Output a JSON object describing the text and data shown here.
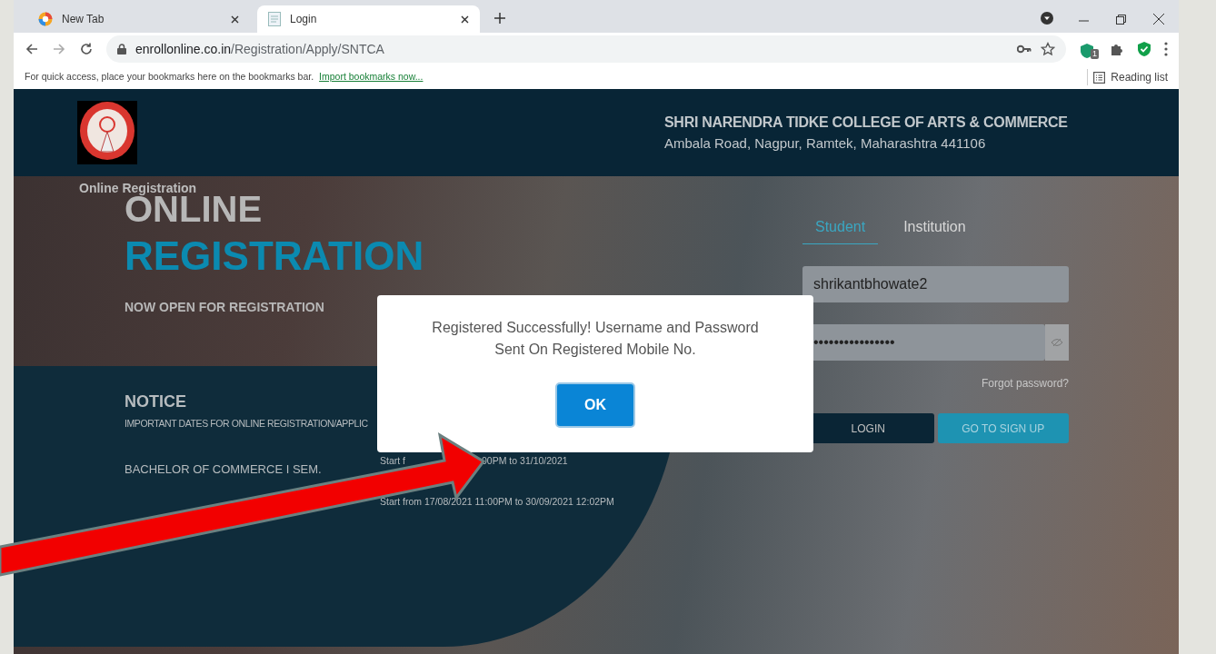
{
  "browser": {
    "tabs": [
      {
        "title": "New Tab",
        "selected": false
      },
      {
        "title": "Login",
        "selected": true
      }
    ],
    "url": {
      "host": "enrollonline.co.in",
      "path": "/Registration/Apply/SNTCA"
    },
    "extension_badge": "1",
    "bookmarks_bar": {
      "message": "For quick access, place your bookmarks here on the bookmarks bar.",
      "link": "Import bookmarks now...",
      "reading_list": "Reading list"
    }
  },
  "page": {
    "college_name": "SHRI NARENDRA TIDKE COLLEGE OF ARTS & COMMERCE",
    "address": "Ambala Road, Nagpur, Ramtek, Maharashtra 441106",
    "breadcrumb": "Online Registration",
    "hero_line_1": "ONLINE",
    "hero_line_2": "REGISTRATION",
    "hero_subtitle": "NOW OPEN FOR REGISTRATION",
    "notice": {
      "title": "NOTICE",
      "subtitle": "IMPORTANT DATES FOR ONLINE REGISTRATION/APPLIC",
      "rows": [
        {
          "course": "BACHELOR OF COMMERCE I SEM.",
          "dates_start": "Start f",
          "dates_end": "00PM to 31/10/2021"
        },
        {
          "dates": "Start from 17/08/2021 11:00PM to 30/09/2021 12:02PM"
        }
      ]
    },
    "login": {
      "tabs": [
        {
          "label": "Student",
          "selected": true
        },
        {
          "label": "Institution",
          "selected": false
        }
      ],
      "username": "shrikantbhowate2",
      "password": "••••••••••••••••",
      "forgot": "Forgot password?",
      "login_button": "LOGIN",
      "signup_button": "GO TO SIGN UP"
    }
  },
  "dialog": {
    "message": "Registered Successfully! Username and Password Sent On Registered Mobile No.",
    "button": "OK"
  }
}
